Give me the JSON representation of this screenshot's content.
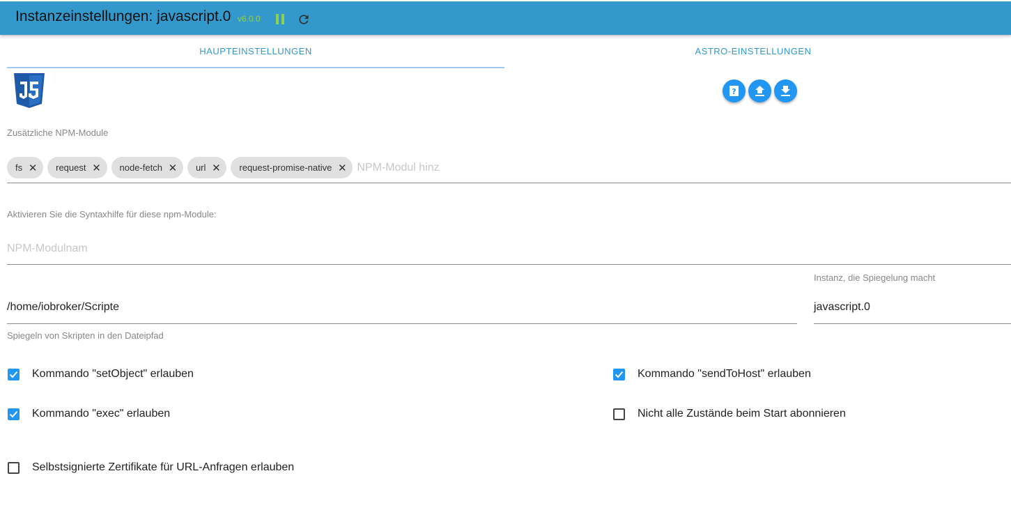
{
  "header": {
    "title": "Instanzeinstellungen: javascript.0",
    "version": "v6.0.0",
    "pause_icon": "pause-icon",
    "refresh_icon": "refresh-icon",
    "colors": {
      "bar": "#3399cc",
      "version": "#8fd14f"
    }
  },
  "tabs": [
    {
      "label": "HAUPTEINSTELLUNGEN",
      "active": true
    },
    {
      "label": "ASTRO-EINSTELLUNGEN",
      "active": false
    }
  ],
  "logo": {
    "text": "JS"
  },
  "actions": [
    {
      "icon": "help-icon"
    },
    {
      "icon": "upload-icon"
    },
    {
      "icon": "download-icon"
    }
  ],
  "npm": {
    "label": "Zusätzliche NPM-Module",
    "chips": [
      "fs",
      "request",
      "node-fetch",
      "url",
      "request-promise-native"
    ],
    "placeholder": "NPM-Modul hinz"
  },
  "syntax": {
    "label": "Aktivieren Sie die Syntaxhilfe für diese npm-Module:",
    "placeholder": "NPM-Modulnam"
  },
  "mirror": {
    "path_value": "/home/iobroker/Scripte",
    "path_helper": "Spiegeln von Skripten in den Dateipfad",
    "instance_label": "Instanz, die Spiegelung macht",
    "instance_value": "javascript.0"
  },
  "checkboxes": {
    "set_object": {
      "label": "Kommando \"setObject\" erlauben",
      "checked": true
    },
    "send_to_host": {
      "label": "Kommando \"sendToHost\" erlauben",
      "checked": true
    },
    "exec": {
      "label": "Kommando \"exec\" erlauben",
      "checked": true
    },
    "no_subscribe": {
      "label": "Nicht alle Zustände beim Start abonnieren",
      "checked": false
    },
    "self_signed": {
      "label": "Selbstsignierte Zertifikate für URL-Anfragen erlauben",
      "checked": false
    }
  },
  "accent_color": "#2196f3"
}
